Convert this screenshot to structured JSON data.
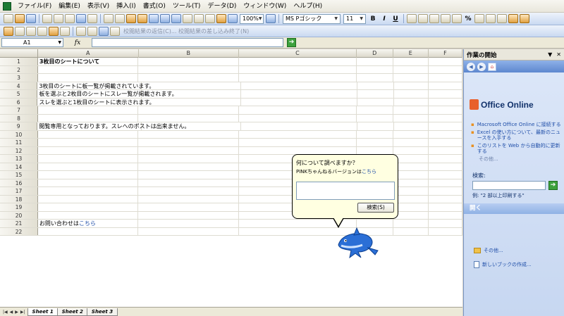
{
  "menu": [
    "ファイル(F)",
    "編集(E)",
    "表示(V)",
    "挿入(I)",
    "書式(O)",
    "ツール(T)",
    "データ(D)",
    "ウィンドウ(W)",
    "ヘルプ(H)"
  ],
  "toolbar": {
    "zoom": "100%",
    "font": "MS Pゴシック",
    "font_size": "11",
    "bold": "B",
    "italic": "I",
    "underline": "U",
    "percent": "%",
    "review_text": "校閲結果の返信(C)... 校閲結果の差し込み終了(N)"
  },
  "formula_bar": {
    "cell_ref": "A1",
    "fx": "fx",
    "content": ""
  },
  "columns": [
    "A",
    "B",
    "C",
    "D",
    "E",
    "F"
  ],
  "rows": [
    {
      "n": "1",
      "a": "3枚目のシートについて",
      "bold": true
    },
    {
      "n": "2",
      "a": ""
    },
    {
      "n": "3",
      "a": ""
    },
    {
      "n": "4",
      "a": "3枚目のシートに板一覧が掲載されています。"
    },
    {
      "n": "5",
      "a": "板を選ぶと2枚目のシートにスレ一覧が掲載されます。"
    },
    {
      "n": "6",
      "a": "スレを選ぶと1枚目のシートに表示されます。"
    },
    {
      "n": "7",
      "a": ""
    },
    {
      "n": "8",
      "a": ""
    },
    {
      "n": "9",
      "a": "閲覧専用となっております。スレへのポストは出来ません。"
    },
    {
      "n": "10",
      "a": ""
    },
    {
      "n": "11",
      "a": ""
    },
    {
      "n": "12",
      "a": ""
    },
    {
      "n": "13",
      "a": ""
    },
    {
      "n": "14",
      "a": ""
    },
    {
      "n": "15",
      "a": ""
    },
    {
      "n": "16",
      "a": ""
    },
    {
      "n": "17",
      "a": ""
    },
    {
      "n": "18",
      "a": ""
    },
    {
      "n": "19",
      "a": ""
    },
    {
      "n": "20",
      "a": ""
    },
    {
      "n": "21",
      "a": "お問い合わせは",
      "link": "こちら"
    },
    {
      "n": "22",
      "a": ""
    }
  ],
  "sheet_tabs": [
    "Sheet 1",
    "Sheet 2",
    "Sheet 3"
  ],
  "task_pane": {
    "title": "作業の開始",
    "office_text": "Office Online",
    "links": [
      "Macrosoft Office Online に接続する",
      "Excel の使い方について、最新のニュースを入手する",
      "このリストを Web から自動的に更新する"
    ],
    "more": "その他...",
    "search_label": "検索:",
    "example": "例: \"2 部以上印刷する\"",
    "open_header": "開く",
    "other": "その他...",
    "new_book": "新しいブックの作成..."
  },
  "balloon": {
    "title": "何について調べますか？",
    "sub_prefix": "PINKちゃんねるバージョンは",
    "sub_link": "こちら",
    "search_button": "検索(S)"
  },
  "colors": {
    "accent": "#5d87cf",
    "link": "#1f4ea8",
    "balloon": "#ffffe1"
  }
}
